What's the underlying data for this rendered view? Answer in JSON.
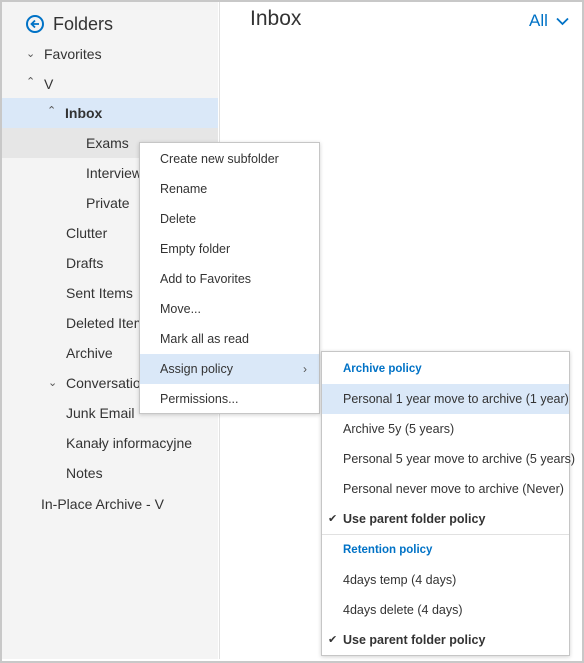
{
  "sidebar": {
    "title": "Folders",
    "items": [
      {
        "label": "Favorites"
      },
      {
        "label": "V"
      },
      {
        "label": "Inbox"
      },
      {
        "label": "Exams"
      },
      {
        "label": "Interview"
      },
      {
        "label": "Private"
      },
      {
        "label": "Clutter"
      },
      {
        "label": "Drafts"
      },
      {
        "label": "Sent Items"
      },
      {
        "label": "Deleted Item"
      },
      {
        "label": "Archive"
      },
      {
        "label": "Conversation"
      },
      {
        "label": "Junk Email"
      },
      {
        "label": "Kanały informacyjne"
      },
      {
        "label": "Notes"
      },
      {
        "label": "In-Place Archive - V"
      }
    ]
  },
  "main": {
    "title": "Inbox",
    "filter_label": "All"
  },
  "context_menu": {
    "items": [
      {
        "label": "Create new subfolder"
      },
      {
        "label": "Rename"
      },
      {
        "label": "Delete"
      },
      {
        "label": "Empty folder"
      },
      {
        "label": "Add to Favorites"
      },
      {
        "label": "Move..."
      },
      {
        "label": "Mark all as read"
      },
      {
        "label": "Assign policy"
      },
      {
        "label": "Permissions..."
      }
    ]
  },
  "policy_menu": {
    "archive_heading": "Archive policy",
    "archive_items": [
      {
        "label": "Personal 1 year move to archive (1 year)"
      },
      {
        "label": "Archive 5y (5 years)"
      },
      {
        "label": "Personal 5 year move to archive (5 years)"
      },
      {
        "label": "Personal never move to archive (Never)"
      },
      {
        "label": "Use parent folder policy"
      }
    ],
    "retention_heading": "Retention policy",
    "retention_items": [
      {
        "label": "4days temp (4 days)"
      },
      {
        "label": "4days delete (4 days)"
      },
      {
        "label": "Use parent folder policy"
      }
    ]
  },
  "colors": {
    "accent": "#0072c6",
    "selected_bg": "#dae8f8",
    "sidebar_bg": "#f4f4f4"
  }
}
